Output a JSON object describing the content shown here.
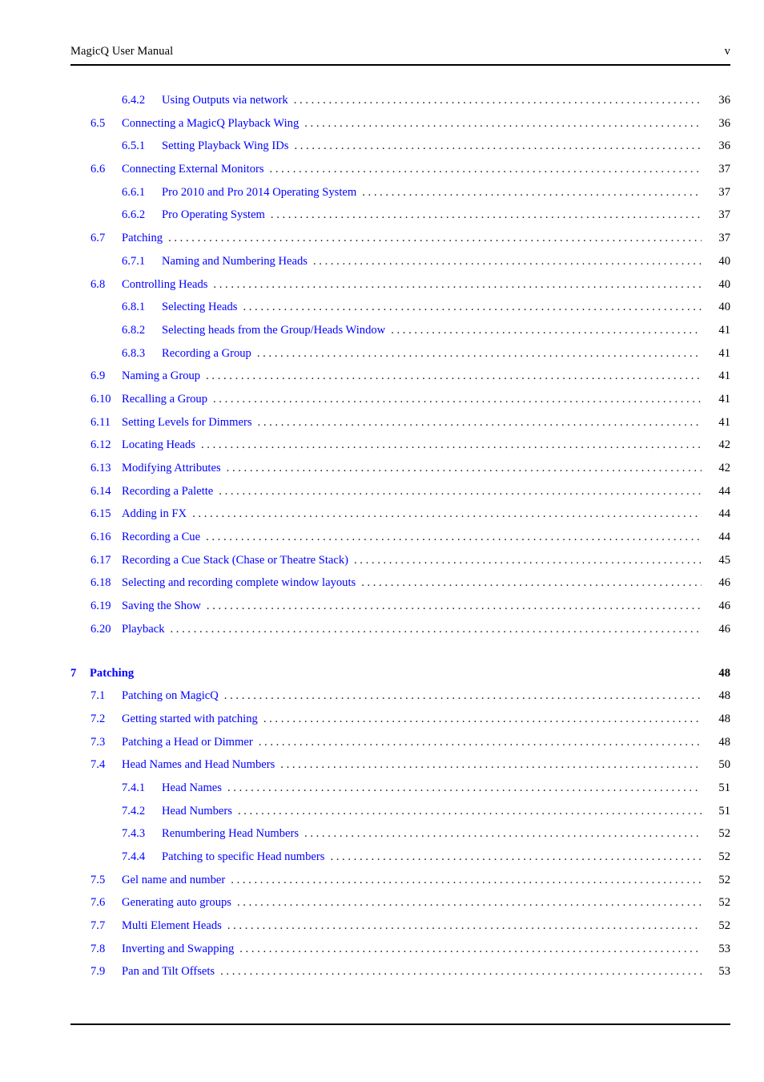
{
  "header": {
    "title": "MagicQ User Manual",
    "folio": "v"
  },
  "toc": {
    "entries": [
      {
        "level": "subsection",
        "number": "6.4.2",
        "title": "Using Outputs via network",
        "page": "36"
      },
      {
        "level": "section",
        "number": "6.5",
        "title": "Connecting a MagicQ Playback Wing",
        "page": "36"
      },
      {
        "level": "subsection",
        "number": "6.5.1",
        "title": "Setting Playback Wing IDs",
        "page": "36"
      },
      {
        "level": "section",
        "number": "6.6",
        "title": "Connecting External Monitors",
        "page": "37"
      },
      {
        "level": "subsection",
        "number": "6.6.1",
        "title": "Pro 2010 and Pro 2014 Operating System",
        "page": "37"
      },
      {
        "level": "subsection",
        "number": "6.6.2",
        "title": "Pro Operating System",
        "page": "37"
      },
      {
        "level": "section",
        "number": "6.7",
        "title": "Patching",
        "page": "37"
      },
      {
        "level": "subsection",
        "number": "6.7.1",
        "title": "Naming and Numbering Heads",
        "page": "40"
      },
      {
        "level": "section",
        "number": "6.8",
        "title": "Controlling Heads",
        "page": "40"
      },
      {
        "level": "subsection",
        "number": "6.8.1",
        "title": "Selecting Heads",
        "page": "40"
      },
      {
        "level": "subsection",
        "number": "6.8.2",
        "title": "Selecting heads from the Group/Heads Window",
        "page": "41"
      },
      {
        "level": "subsection",
        "number": "6.8.3",
        "title": "Recording a Group",
        "page": "41"
      },
      {
        "level": "section",
        "number": "6.9",
        "title": "Naming a Group",
        "page": "41"
      },
      {
        "level": "section",
        "number": "6.10",
        "title": "Recalling a Group",
        "page": "41"
      },
      {
        "level": "section",
        "number": "6.11",
        "title": "Setting Levels for Dimmers",
        "page": "41"
      },
      {
        "level": "section",
        "number": "6.12",
        "title": "Locating Heads",
        "page": "42"
      },
      {
        "level": "section",
        "number": "6.13",
        "title": "Modifying Attributes",
        "page": "42"
      },
      {
        "level": "section",
        "number": "6.14",
        "title": "Recording a Palette",
        "page": "44"
      },
      {
        "level": "section",
        "number": "6.15",
        "title": "Adding in FX",
        "page": "44"
      },
      {
        "level": "section",
        "number": "6.16",
        "title": "Recording a Cue",
        "page": "44"
      },
      {
        "level": "section",
        "number": "6.17",
        "title": "Recording a Cue Stack (Chase or Theatre Stack)",
        "page": "45"
      },
      {
        "level": "section",
        "number": "6.18",
        "title": "Selecting and recording complete window layouts",
        "page": "46"
      },
      {
        "level": "section",
        "number": "6.19",
        "title": "Saving the Show",
        "page": "46"
      },
      {
        "level": "section",
        "number": "6.20",
        "title": "Playback",
        "page": "46"
      },
      {
        "level": "spacer",
        "number": "",
        "title": "",
        "page": ""
      },
      {
        "level": "chapter",
        "number": "7",
        "title": "Patching",
        "page": "48"
      },
      {
        "level": "section",
        "number": "7.1",
        "title": "Patching on MagicQ",
        "page": "48"
      },
      {
        "level": "section",
        "number": "7.2",
        "title": "Getting started with patching",
        "page": "48"
      },
      {
        "level": "section",
        "number": "7.3",
        "title": "Patching a Head or Dimmer",
        "page": "48"
      },
      {
        "level": "section",
        "number": "7.4",
        "title": "Head Names and Head Numbers",
        "page": "50"
      },
      {
        "level": "subsection",
        "number": "7.4.1",
        "title": "Head Names",
        "page": "51"
      },
      {
        "level": "subsection",
        "number": "7.4.2",
        "title": "Head Numbers",
        "page": "51"
      },
      {
        "level": "subsection",
        "number": "7.4.3",
        "title": "Renumbering Head Numbers",
        "page": "52"
      },
      {
        "level": "subsection",
        "number": "7.4.4",
        "title": "Patching to specific Head numbers",
        "page": "52"
      },
      {
        "level": "section",
        "number": "7.5",
        "title": "Gel name and number",
        "page": "52"
      },
      {
        "level": "section",
        "number": "7.6",
        "title": "Generating auto groups",
        "page": "52"
      },
      {
        "level": "section",
        "number": "7.7",
        "title": "Multi Element Heads",
        "page": "52"
      },
      {
        "level": "section",
        "number": "7.8",
        "title": "Inverting and Swapping",
        "page": "53"
      },
      {
        "level": "section",
        "number": "7.9",
        "title": "Pan and Tilt Offsets",
        "page": "53"
      }
    ]
  },
  "colors": {
    "link": "#0000ff",
    "text": "#000000",
    "rule": "#000000"
  }
}
